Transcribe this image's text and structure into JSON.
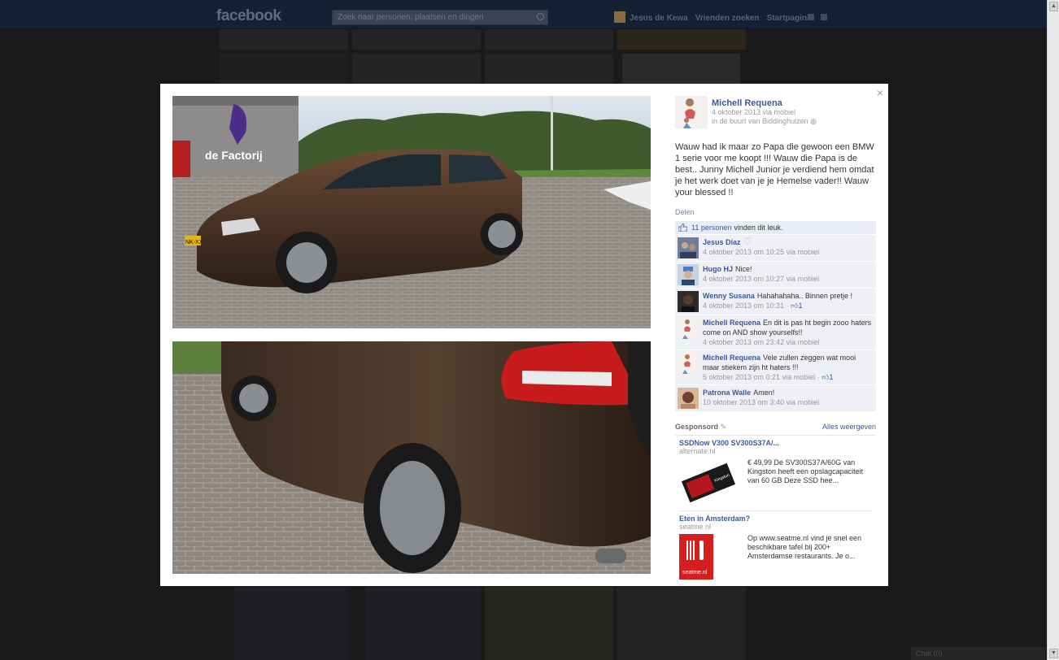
{
  "topbar": {
    "logo": "facebook",
    "search_placeholder": "Zoek naar personen, plaatsen en dingen",
    "links": [
      "Jesus de Kewa",
      "Vrienden zoeken",
      "Startpagina"
    ]
  },
  "post": {
    "author": "Michell Requena",
    "date": "4 oktober 2013 via mobiel",
    "location": "in de buurt van Biddinghuizen",
    "text": "Wauw had ik maar zo Papa die gewoon een BMW 1 serie voor me koopt !!! Wauw die Papa is de best.. Junny Michell Junior je verdiend hem omdat je het werk doet van je je Hemelse vader!! Wauw your blessed !!",
    "share_label": "Delen",
    "likes_count": "11 personen",
    "likes_suffix": "vinden dit leuk."
  },
  "comments": [
    {
      "name": "Jesus Díaz",
      "text": "",
      "meta": "4 oktober 2013 om 10:25 via mobiel",
      "likes": ""
    },
    {
      "name": "Hugo HJ",
      "text": "Nice!",
      "meta": "4 oktober 2013 om 10:27 via mobiel",
      "likes": ""
    },
    {
      "name": "Wenny Susana",
      "text": "Hahahahaha.. Binnen pretje !",
      "meta": "4 oktober 2013 om 10:31 ·",
      "likes": "1"
    },
    {
      "name": "Michell Requena",
      "text": "En dit is pas ht begin zooo haters come on AND show yourselfs!!",
      "meta": "4 oktober 2013 om 23:42 via mobiel",
      "likes": ""
    },
    {
      "name": "Michell Requena",
      "text": "Vele zullen zeggen wat mooi maar stiekem zijn ht haters !!!",
      "meta": "5 oktober 2013 om 0:21 via mobiel ·",
      "likes": "1"
    },
    {
      "name": "Patrona Walle",
      "text": "Amen!",
      "meta": "10 oktober 2013 om 3:40 via mobiel",
      "likes": ""
    }
  ],
  "sponsored": {
    "label": "Gesponsord",
    "see_all": "Alles weergeven",
    "ads": [
      {
        "title": "SSDNow V300 SV300S37A/...",
        "domain": "alternate.nl",
        "text": "€ 49,99 De SV300S37A/60G van Kingston heeft een opslagcapaciteit van 60 GB Deze SSD hee..."
      },
      {
        "title": "Eten in Amsterdam?",
        "domain": "seatme.nl",
        "text": "Op www.seatme.nl vind je snel een beschikbare tafel bij 200+ Amsterdamse restaurants. Je o..."
      }
    ]
  },
  "photo_signs": {
    "building": "de Factorij",
    "plate": "NK-XX"
  },
  "ad_logo_text": {
    "kingston": "Kingston",
    "seatme": "seatme.nl"
  },
  "chat_label": "Chat (0)",
  "close_glyph": "×",
  "colors": {
    "link": "#3b5998",
    "car_brown": "#4a3324",
    "modal_bg": "#ffffff",
    "overlay": "#1b1b1b"
  }
}
